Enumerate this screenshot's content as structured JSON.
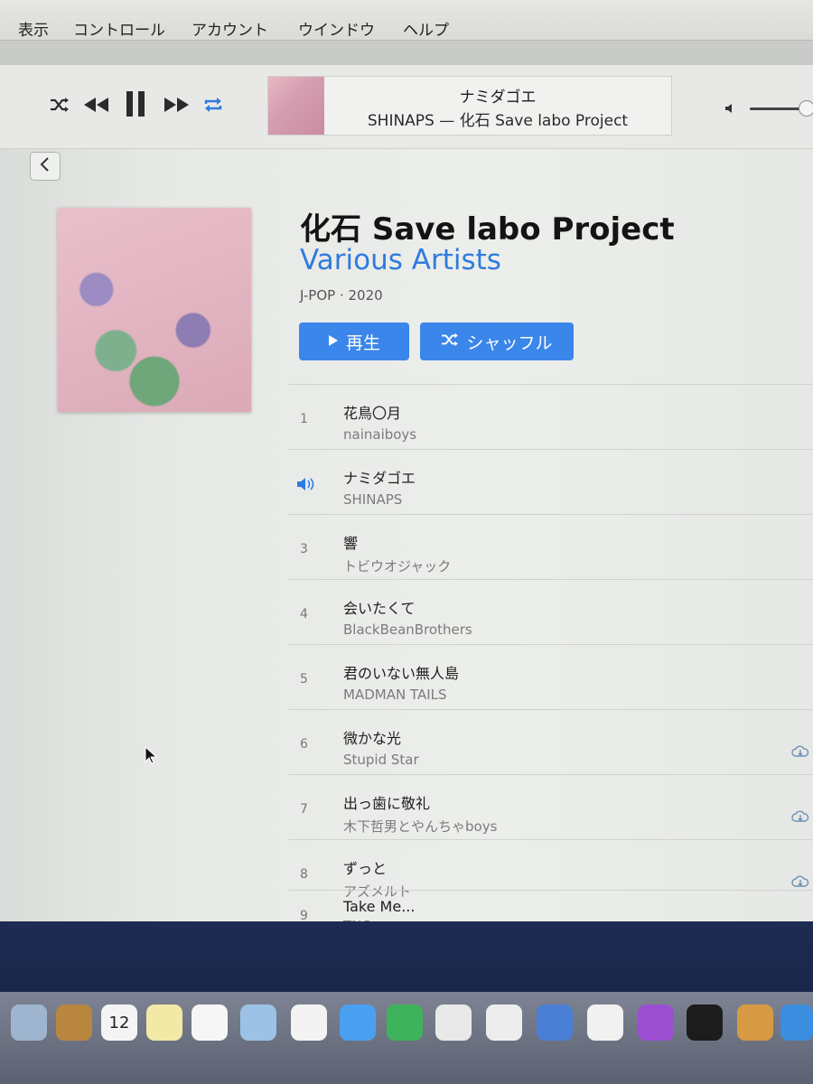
{
  "menubar": {
    "items": [
      "表示",
      "コントロール",
      "アカウント",
      "ウインドウ",
      "ヘルプ"
    ]
  },
  "player": {
    "now_playing_title": "ナミダゴエ",
    "now_playing_subtitle": "SHINAPS — 化石 Save labo Project",
    "icons": [
      "shuffle-icon",
      "rewind-icon",
      "pause-icon",
      "fast-forward-icon",
      "repeat-icon",
      "volume-icon"
    ]
  },
  "album": {
    "title": "化石 Save labo Project",
    "artist": "Various Artists",
    "meta": "J-POP · 2020"
  },
  "actions": {
    "play_label": "再生",
    "shuffle_label": "シャッフル"
  },
  "tracks": [
    {
      "num": "1",
      "title": "花鳥〇月",
      "artist": "nainaiboys",
      "playing": false
    },
    {
      "num": "",
      "title": "ナミダゴエ",
      "artist": "SHINAPS",
      "playing": true
    },
    {
      "num": "3",
      "title": "響",
      "artist": "トビウオジャック",
      "playing": false
    },
    {
      "num": "4",
      "title": "会いたくて",
      "artist": "BlackBeanBrothers",
      "playing": false
    },
    {
      "num": "5",
      "title": "君のいない無人島",
      "artist": "MADMAN TAILS",
      "playing": false
    },
    {
      "num": "6",
      "title": "微かな光",
      "artist": "Stupid Star",
      "playing": false
    },
    {
      "num": "7",
      "title": "出っ歯に敬礼",
      "artist": "木下哲男とやんちゃboys",
      "playing": false
    },
    {
      "num": "8",
      "title": "ずっと",
      "artist": "アズメルト",
      "playing": false
    },
    {
      "num": "9",
      "title": "Take Me...",
      "artist": "TNO",
      "playing": false
    }
  ],
  "dock": {
    "calendar_day": "12"
  },
  "colors": {
    "accent": "#3a86ea",
    "link": "#2f7be0"
  }
}
